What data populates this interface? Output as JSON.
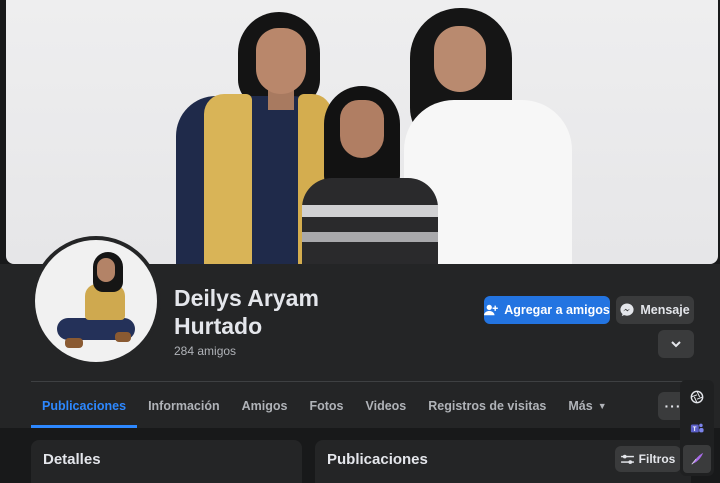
{
  "profile": {
    "name": "Deilys Aryam Hurtado",
    "friends_count": "284 amigos"
  },
  "actions": {
    "add_friend": "Agregar a amigos",
    "message": "Mensaje",
    "more_icon": "chevron-down-icon",
    "options_icon": "more-dots-icon"
  },
  "tabs": [
    {
      "label": "Publicaciones",
      "active": true
    },
    {
      "label": "Información",
      "active": false
    },
    {
      "label": "Amigos",
      "active": false
    },
    {
      "label": "Fotos",
      "active": false
    },
    {
      "label": "Videos",
      "active": false
    },
    {
      "label": "Registros de visitas",
      "active": false
    },
    {
      "label": "Más",
      "active": false
    }
  ],
  "sections": {
    "details_title": "Detalles",
    "posts_title": "Publicaciones",
    "filters_label": "Filtros"
  },
  "colors": {
    "accent": "#2d88ff",
    "primary_button": "#2374e1",
    "background": "#18191a",
    "surface": "#242526"
  }
}
